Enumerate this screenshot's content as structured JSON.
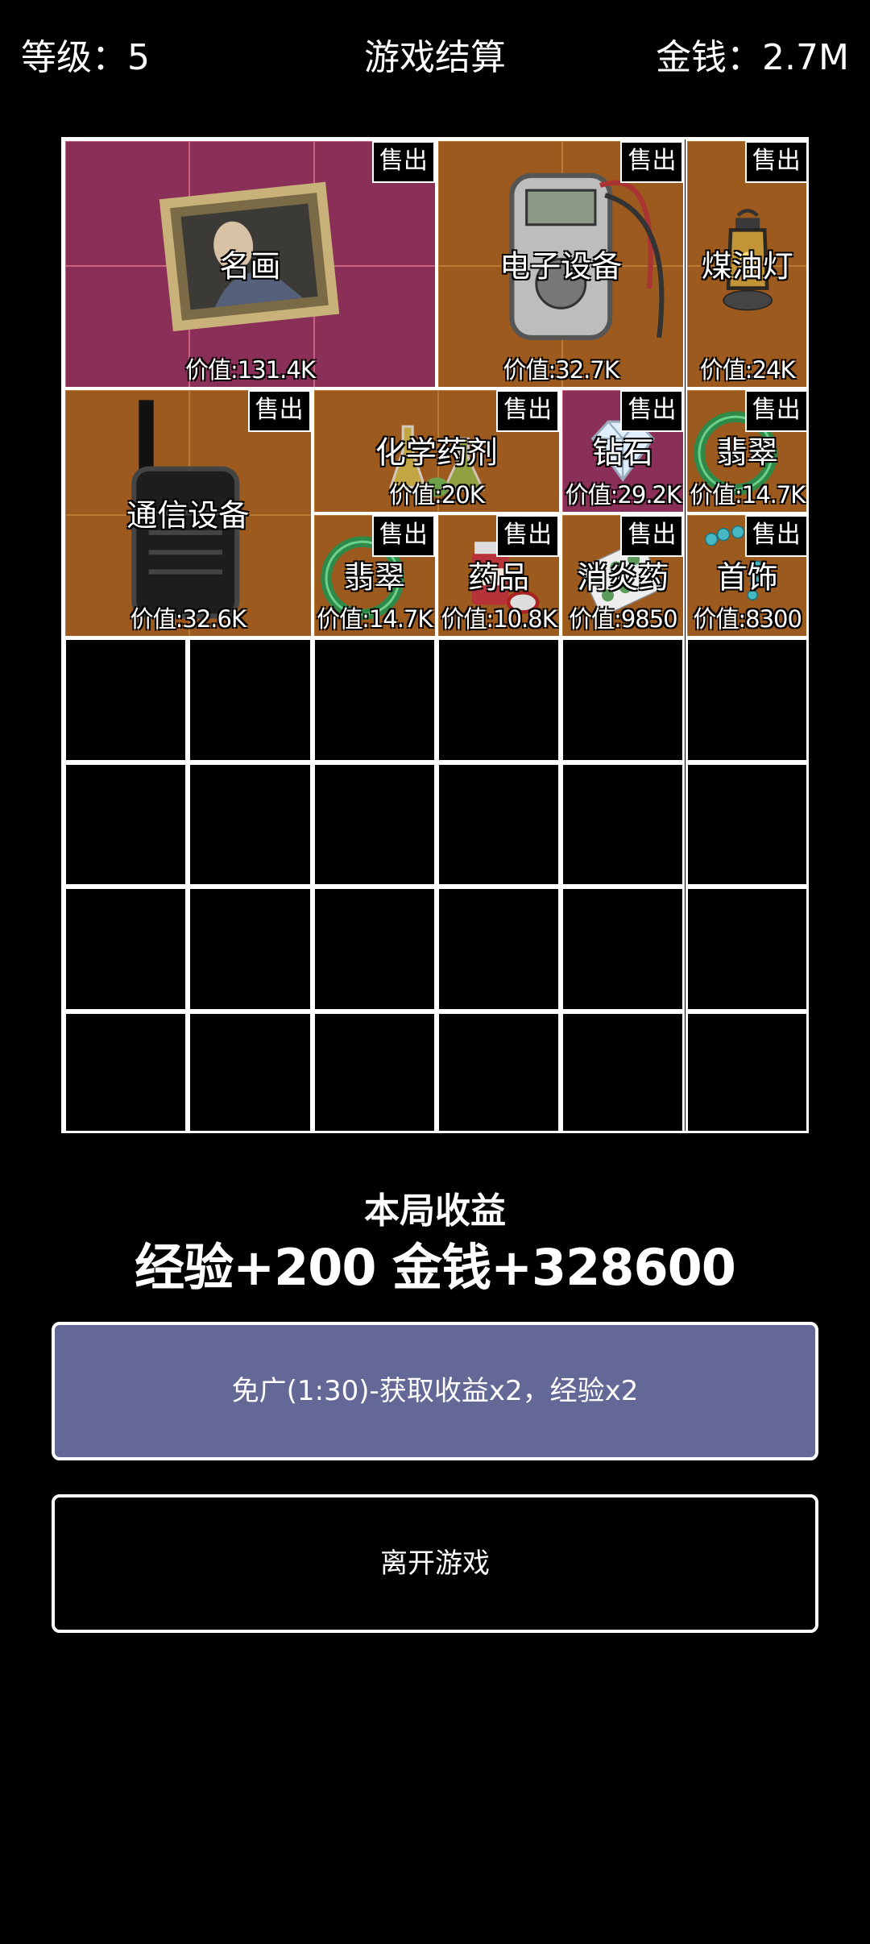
{
  "header": {
    "level_label": "等级：5",
    "title": "游戏结算",
    "money_label": "金钱：2.7M"
  },
  "sell_label": "售出",
  "items": [
    {
      "name": "名画",
      "value": "价值:131.4K",
      "bg": "purple",
      "icon": "painting-icon"
    },
    {
      "name": "电子设备",
      "value": "价值:32.7K",
      "bg": "orange",
      "icon": "multimeter-icon"
    },
    {
      "name": "煤油灯",
      "value": "价值:24K",
      "bg": "orange",
      "icon": "lantern-icon"
    },
    {
      "name": "通信设备",
      "value": "价值:32.6K",
      "bg": "orange",
      "icon": "walkie-talkie-icon"
    },
    {
      "name": "化学药剂",
      "value": "价值:20K",
      "bg": "orange",
      "icon": "flask-icon"
    },
    {
      "name": "钻石",
      "value": "价值:29.2K",
      "bg": "purple",
      "icon": "diamond-icon"
    },
    {
      "name": "翡翠",
      "value": "价值:14.7K",
      "bg": "orange",
      "icon": "jade-bangle-icon"
    },
    {
      "name": "翡翠",
      "value": "价值:14.7K",
      "bg": "orange",
      "icon": "jade-bangle-icon"
    },
    {
      "name": "药品",
      "value": "价值:10.8K",
      "bg": "orange",
      "icon": "medicine-bottle-icon"
    },
    {
      "name": "消炎药",
      "value": "价值:9850",
      "bg": "orange",
      "icon": "pill-pack-icon"
    },
    {
      "name": "首饰",
      "value": "价值:8300",
      "bg": "orange",
      "icon": "necklace-icon"
    }
  ],
  "earnings": {
    "title": "本局收益",
    "detail": "经验+200 金钱+328600"
  },
  "buttons": {
    "ad_label": "免广(1:30)-获取收益x2，经验x2",
    "leave_label": "离开游戏"
  },
  "colors": {
    "background": "#000000",
    "item_purple": "#8a2f58",
    "item_orange": "#9c5a1e",
    "ad_button": "#636896"
  }
}
